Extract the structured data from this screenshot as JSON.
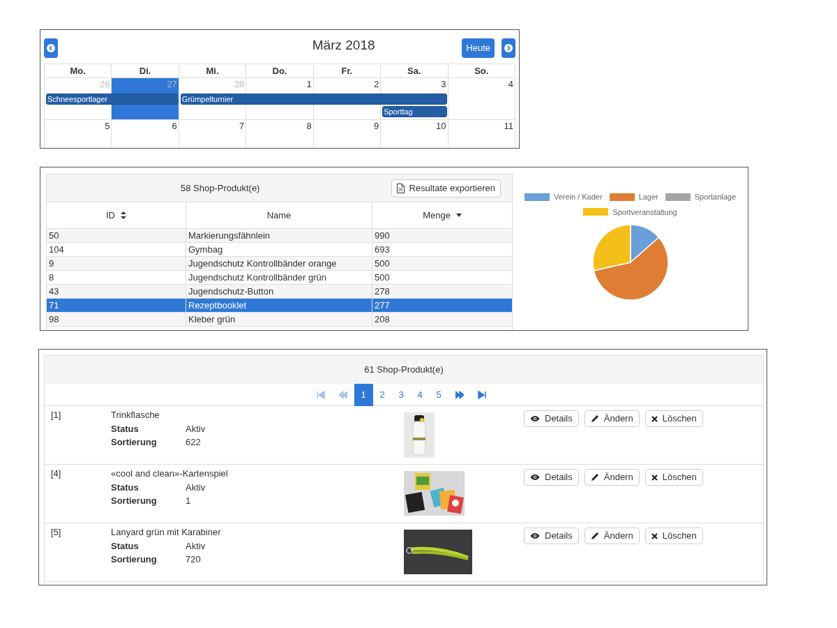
{
  "calendar": {
    "title": "März 2018",
    "today_button": "Heute",
    "weekdays": [
      "Mo.",
      "Di.",
      "Mi.",
      "Do.",
      "Fr.",
      "Sa.",
      "So."
    ],
    "weeks": [
      {
        "days": [
          {
            "number": "26",
            "muted": true,
            "today": false,
            "events": [
              {
                "kind": "start",
                "title": "Schneesportlager"
              }
            ]
          },
          {
            "number": "27",
            "muted": true,
            "today": true,
            "events": [
              {
                "kind": "continue"
              }
            ]
          },
          {
            "number": "28",
            "muted": true,
            "today": false,
            "events": [
              {
                "kind": "start",
                "title": "Grümpelturnier"
              }
            ]
          },
          {
            "number": "1",
            "muted": false,
            "today": false,
            "events": [
              {
                "kind": "continue"
              }
            ]
          },
          {
            "number": "2",
            "muted": false,
            "today": false,
            "events": [
              {
                "kind": "continue"
              }
            ]
          },
          {
            "number": "3",
            "muted": false,
            "today": false,
            "events": [
              {
                "kind": "continue"
              },
              {
                "kind": "start",
                "title": "Sporttag"
              }
            ]
          },
          {
            "number": "4",
            "muted": false,
            "today": false
          }
        ]
      },
      {
        "days": [
          {
            "number": "5",
            "muted": false,
            "today": false
          },
          {
            "number": "6",
            "muted": false,
            "today": false
          },
          {
            "number": "7",
            "muted": false,
            "today": false
          },
          {
            "number": "8",
            "muted": false,
            "today": false
          },
          {
            "number": "9",
            "muted": false,
            "today": false
          },
          {
            "number": "10",
            "muted": false,
            "today": false
          },
          {
            "number": "11",
            "muted": false,
            "today": false
          }
        ]
      }
    ]
  },
  "stock_table": {
    "title": "58 Shop-Produkt(e)",
    "export_button": "Resultate exportieren",
    "columns": [
      {
        "label": "ID",
        "kind": "sortable"
      },
      {
        "label": "Name",
        "kind": "plain"
      },
      {
        "label": "Menge",
        "kind": "descending"
      }
    ],
    "rows": [
      {
        "cells": [
          "50",
          "Markierungsfähnlein",
          "990"
        ],
        "selected": false
      },
      {
        "cells": [
          "104",
          "Gymbag",
          "693"
        ],
        "selected": false
      },
      {
        "cells": [
          "9",
          "Jugendschutz Kontrollbänder orange",
          "500"
        ],
        "selected": false
      },
      {
        "cells": [
          "8",
          "Jugendschutz Kontrollbänder grün",
          "500"
        ],
        "selected": false
      },
      {
        "cells": [
          "43",
          "Jugendschutz-Button",
          "278"
        ],
        "selected": false
      },
      {
        "cells": [
          "71",
          "Rezeptbooklet",
          "277"
        ],
        "selected": true
      },
      {
        "cells": [
          "98",
          "Kleber grün",
          "208"
        ],
        "selected": false
      }
    ]
  },
  "chart_legend": [
    {
      "label": "Verein / Kader",
      "color": "#6a9fd8"
    },
    {
      "label": "Lager",
      "color": "#e07d35"
    },
    {
      "label": "Sportanlage",
      "color": "#a5a5a5"
    },
    {
      "label": "Sportveranstaltung",
      "color": "#f5bf19"
    }
  ],
  "product_list": {
    "title": "61 Shop-Produkt(e)",
    "pagination": [
      {
        "kind": "first",
        "disabled": true
      },
      {
        "kind": "prev",
        "disabled": true
      },
      {
        "kind": "page",
        "label": "1",
        "selected": true
      },
      {
        "kind": "page",
        "label": "2",
        "selected": false
      },
      {
        "kind": "page",
        "label": "3",
        "selected": false
      },
      {
        "kind": "page",
        "label": "4",
        "selected": false
      },
      {
        "kind": "page",
        "label": "5",
        "selected": false
      },
      {
        "kind": "next",
        "disabled": false
      },
      {
        "kind": "last",
        "disabled": false
      }
    ],
    "items": [
      {
        "index": "[1]",
        "name": "Trinkflasche",
        "fields": [
          {
            "label": "Status",
            "value": "Aktiv"
          },
          {
            "label": "Sortierung",
            "value": "622"
          }
        ],
        "buttons": [
          {
            "kind": "details",
            "label": "Details"
          },
          {
            "kind": "edit",
            "label": "Ändern"
          },
          {
            "kind": "delete",
            "label": "Löschen"
          }
        ]
      },
      {
        "index": "[4]",
        "name": "«cool and clean»-Kartenspiel",
        "fields": [
          {
            "label": "Status",
            "value": "Aktiv"
          },
          {
            "label": "Sortierung",
            "value": "1"
          }
        ],
        "buttons": [
          {
            "kind": "details",
            "label": "Details"
          },
          {
            "kind": "edit",
            "label": "Ändern"
          },
          {
            "kind": "delete",
            "label": "Löschen"
          }
        ]
      },
      {
        "index": "[5]",
        "name": "Lanyard grün mit Karabiner",
        "fields": [
          {
            "label": "Status",
            "value": "Aktiv"
          },
          {
            "label": "Sortierung",
            "value": "720"
          }
        ],
        "buttons": [
          {
            "kind": "details",
            "label": "Details"
          },
          {
            "kind": "edit",
            "label": "Ändern"
          },
          {
            "kind": "delete",
            "label": "Löschen"
          }
        ]
      }
    ]
  }
}
